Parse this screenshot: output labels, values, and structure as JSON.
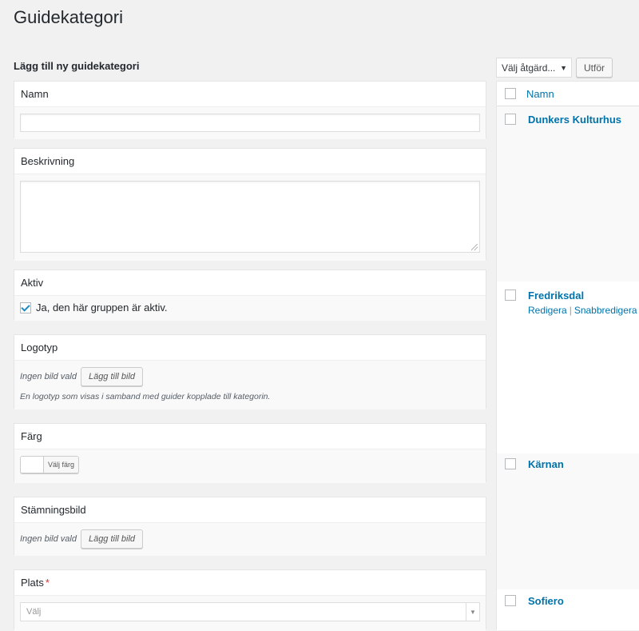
{
  "page": {
    "title": "Guidekategori"
  },
  "form": {
    "heading": "Lägg till ny guidekategori",
    "name": {
      "label": "Namn",
      "value": ""
    },
    "description": {
      "label": "Beskrivning",
      "value": ""
    },
    "active": {
      "label": "Aktiv",
      "checkbox_label": "Ja, den här gruppen är aktiv.",
      "checked": true
    },
    "logo": {
      "label": "Logotyp",
      "status": "Ingen bild vald",
      "button": "Lägg till bild",
      "hint": "En logotyp som visas i samband med guider kopplade till kategorin."
    },
    "color": {
      "label": "Färg",
      "button": "Välj färg"
    },
    "mood_image": {
      "label": "Stämningsbild",
      "status": "Ingen bild vald",
      "button": "Lägg till bild"
    },
    "place": {
      "label": "Plats",
      "required_mark": "*",
      "placeholder": "Välj"
    }
  },
  "list": {
    "bulk_action": "Välj åtgärd...",
    "apply": "Utför",
    "column_name": "Namn",
    "rows": [
      {
        "name": "Dunkers Kulturhus"
      },
      {
        "name": "Fredriksdal",
        "actions": [
          "Redigera",
          "Snabbredigera"
        ]
      },
      {
        "name": "Kärnan"
      },
      {
        "name": "Sofiero"
      }
    ]
  },
  "colors": {
    "link": "#0073aa",
    "required": "#dc3232",
    "check": "#1e8cbe"
  }
}
